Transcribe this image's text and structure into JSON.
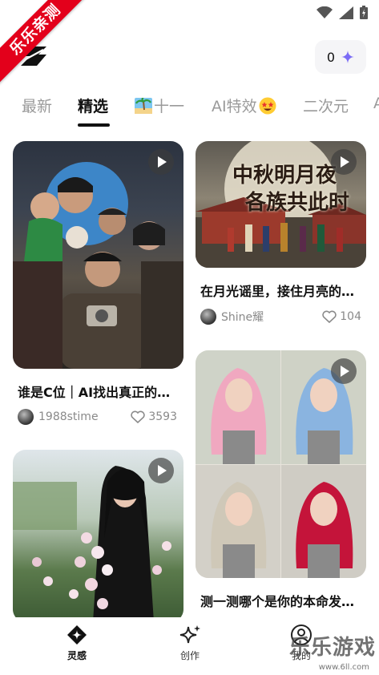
{
  "watermark": {
    "ribbon": "乐乐亲测",
    "corner": "乐乐游戏",
    "url": "www.6ll.com"
  },
  "header": {
    "coin_count": "0",
    "logo_icon": "app-logo-icon",
    "spark_icon": "sparkle-icon"
  },
  "tabs": [
    {
      "label": "最新",
      "active": false
    },
    {
      "label": "精选",
      "active": true
    },
    {
      "label": "十一",
      "active": false,
      "icon": "beach-emoji"
    },
    {
      "label": "AI特效",
      "active": false,
      "icon": "star-eyes-emoji"
    },
    {
      "label": "二次元",
      "active": false
    },
    {
      "label": "A",
      "active": false
    }
  ],
  "feed": {
    "left": [
      {
        "title": "谁是C位｜AI找出真正的…",
        "author": "1988stime",
        "likes": "3593",
        "has_play": true
      },
      {
        "title": "",
        "author": "",
        "likes": "",
        "has_play": true
      }
    ],
    "right": [
      {
        "title": "在月光谣里，接住月亮的…",
        "author": "Shine耀",
        "likes": "104",
        "has_play": true,
        "image_text": [
          "中秋明月夜",
          "各族共此时"
        ]
      },
      {
        "title": "测一测哪个是你的本命发…",
        "author": "",
        "likes": "",
        "has_play": true
      }
    ]
  },
  "bottom_nav": [
    {
      "label": "灵感",
      "icon": "inspiration-icon",
      "active": true
    },
    {
      "label": "创作",
      "icon": "sparkle-create-icon",
      "active": false
    },
    {
      "label": "我的",
      "icon": "profile-icon",
      "active": false
    }
  ],
  "colors": {
    "accent": "#111111",
    "inactive": "#9a9a9a",
    "ribbon": "#e3001b",
    "spark": "#7b6cf6"
  }
}
